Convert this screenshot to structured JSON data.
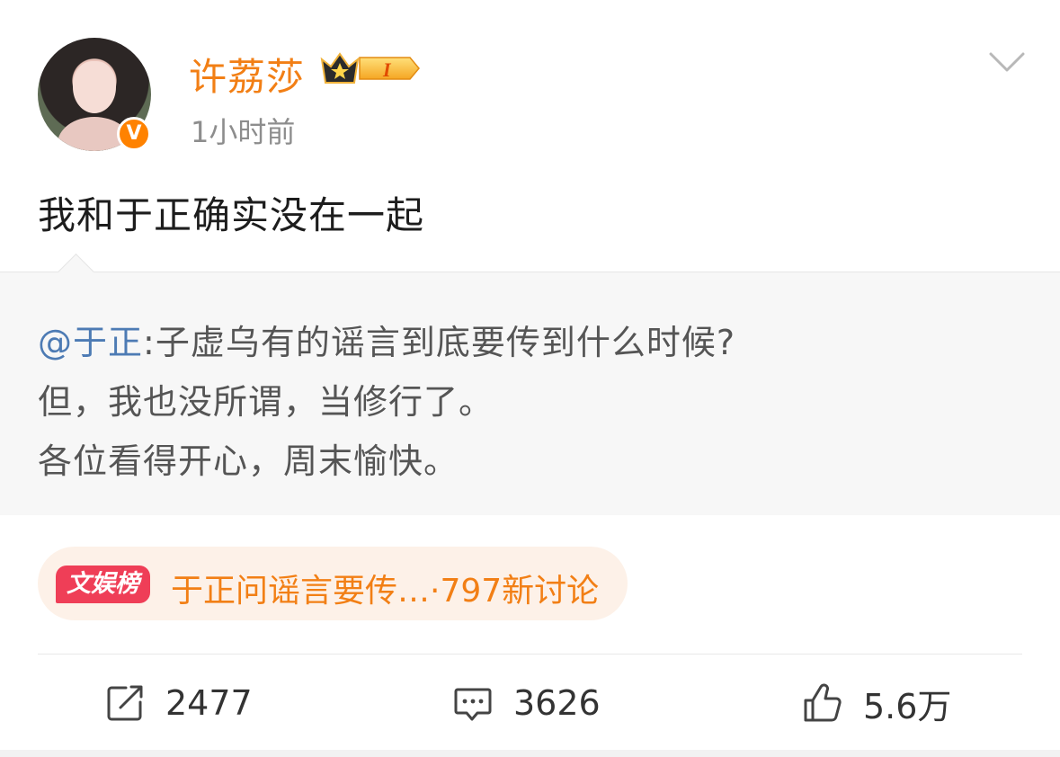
{
  "post": {
    "author": {
      "name": "许荔莎",
      "verified_badge": "V",
      "level_badge": "I"
    },
    "timestamp": "1小时前",
    "text": "我和于正确实没在一起"
  },
  "quote": {
    "mention": "@于正",
    "line1_rest": ":子虚乌有的谣言到底要传到什么时候?",
    "line2": "但，我也没所谓，当修行了。",
    "line3": "各位看得开心，周末愉快。"
  },
  "topic": {
    "tag": "文娱榜",
    "text": "于正问谣言要传…·797新讨论"
  },
  "actions": {
    "repost_count": "2477",
    "comment_count": "3626",
    "like_count": "5.6万"
  },
  "colors": {
    "accent_orange": "#f27f15",
    "mention_blue": "#4d7bb4",
    "tag_red": "#ef3e57",
    "verified_orange": "#ff8200"
  }
}
